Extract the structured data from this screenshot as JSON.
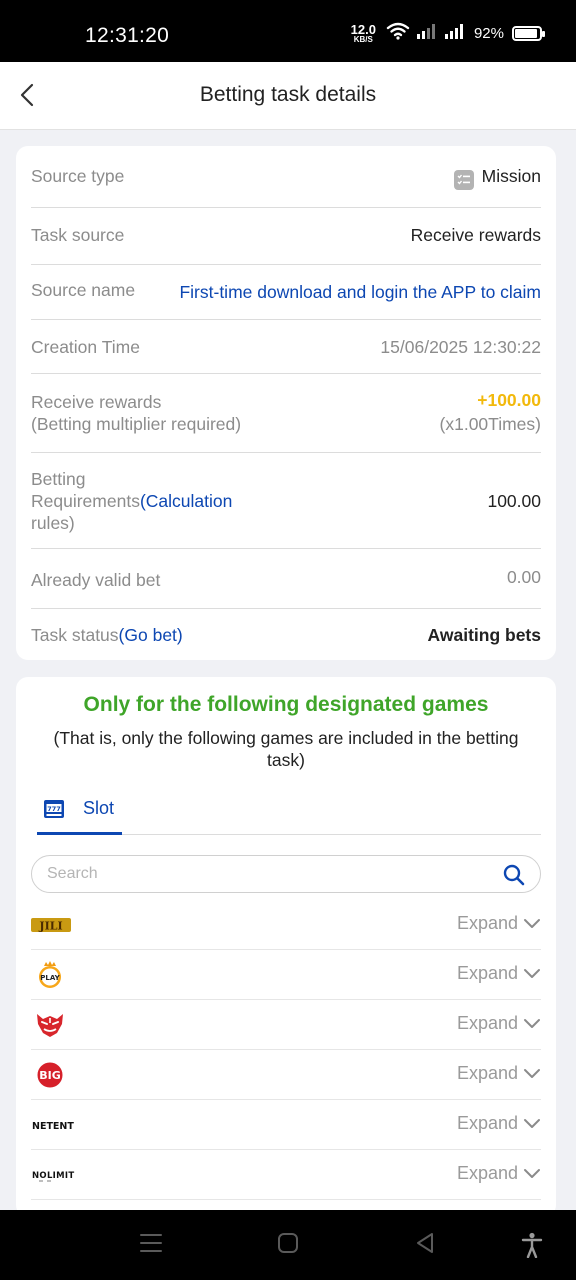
{
  "status_bar": {
    "time": "12:31:20",
    "net_speed_value": "12.0",
    "net_speed_unit": "KB/S",
    "battery_percent": "92%",
    "battery_level": 0.92
  },
  "header": {
    "title": "Betting task details"
  },
  "details": {
    "source_type_label": "Source type",
    "source_type_value": "Mission",
    "task_source_label": "Task source",
    "task_source_value": "Receive rewards",
    "source_name_label": "Source name",
    "source_name_value": "First-time download and login the APP to claim",
    "creation_time_label": "Creation Time",
    "creation_time_value": "15/06/2025 12:30:22",
    "receive_rewards_label": "Receive rewards",
    "receive_rewards_sublabel": "(Betting multiplier required)",
    "receive_rewards_value": "+100.00",
    "receive_rewards_multiplier": "(x1.00Times)",
    "betting_req_label": "Betting",
    "betting_req_label2": "Requirements",
    "betting_req_link": "(Calculation",
    "betting_req_link2": "rules)",
    "betting_req_value": "100.00",
    "valid_bet_label": "Already valid bet",
    "valid_bet_value": "0.00",
    "task_status_label": "Task status",
    "task_status_link": "(Go bet)",
    "task_status_value": "Awaiting bets"
  },
  "games": {
    "title": "Only for the following designated games",
    "subtitle": "(That is, only the following games are included in the betting task)",
    "tab_label": "Slot",
    "search_placeholder": "Search",
    "expand_label": "Expand",
    "providers": [
      {
        "logo": "JILI"
      },
      {
        "logo": "PLAY"
      },
      {
        "logo": "red-tiger-logo"
      },
      {
        "logo": "BIG"
      },
      {
        "logo": "NETENT"
      },
      {
        "logo": "NOLIMIT"
      }
    ]
  },
  "colors": {
    "accent_blue": "#0d47b2",
    "reward_yellow": "#f2b90c",
    "title_green": "#3fa529"
  }
}
